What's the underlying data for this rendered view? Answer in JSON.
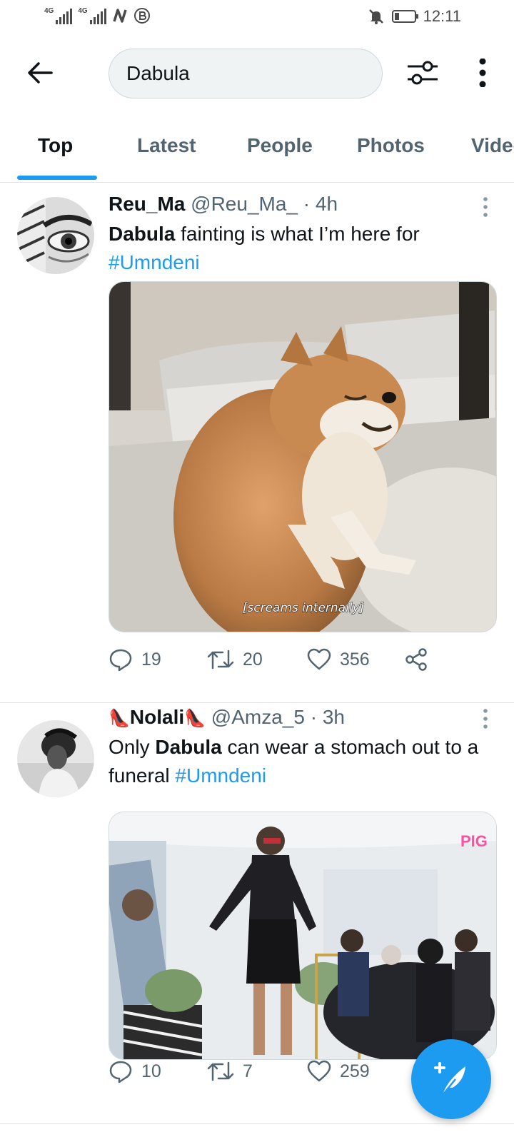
{
  "status_bar": {
    "signal1_label": "4G",
    "signal2_label": "4G",
    "time": "12:11"
  },
  "header": {
    "search_value": "Dabula"
  },
  "tabs": [
    {
      "label": "Top",
      "active": true
    },
    {
      "label": "Latest",
      "active": false
    },
    {
      "label": "People",
      "active": false
    },
    {
      "label": "Photos",
      "active": false
    },
    {
      "label": "Videos",
      "active": false
    }
  ],
  "tweets": [
    {
      "name": "Reu_Ma",
      "handle": "@Reu_Ma_",
      "time": "· 4h",
      "text_bold": "Dabula",
      "text_rest": " fainting is what I’m here for",
      "hashtag": "#Umndeni",
      "media_caption": "[screams internally]",
      "replies": "19",
      "retweets": "20",
      "likes": "356"
    },
    {
      "name": "Nolali",
      "name_emoji": "👠",
      "handle": "@Amza_5",
      "time": "· 3h",
      "text_pre": "Only ",
      "text_bold": "Dabula",
      "text_rest": " can wear a stomach out to a funeral ",
      "hashtag": "#Umndeni",
      "media_watermark": "PIG",
      "replies": "10",
      "retweets": "7",
      "likes": "259"
    }
  ],
  "icons": {
    "back": "arrow-left-icon",
    "filter": "sliders-icon",
    "more": "more-vertical-icon",
    "reply": "speech-bubble-icon",
    "retweet": "retweet-icon",
    "like": "heart-icon",
    "share": "share-icon",
    "compose": "compose-feather-icon"
  },
  "colors": {
    "accent": "#1d9bf0",
    "text_primary": "#0f1419",
    "text_secondary": "#536471"
  }
}
